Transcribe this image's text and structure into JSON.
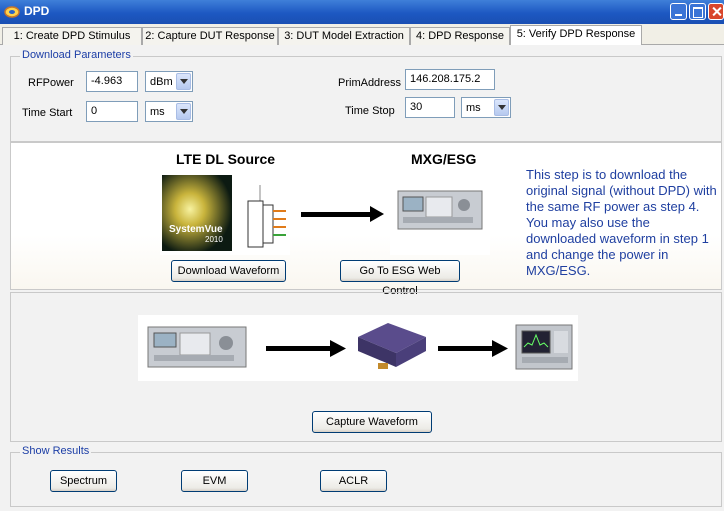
{
  "window": {
    "title": "DPD"
  },
  "tabs": [
    {
      "label": "1: Create DPD Stimulus"
    },
    {
      "label": "2: Capture DUT Response"
    },
    {
      "label": "3: DUT Model Extraction"
    },
    {
      "label": "4: DPD Response"
    },
    {
      "label": "5: Verify DPD Response"
    }
  ],
  "download_params": {
    "legend": "Download Parameters",
    "rfpower_label": "RFPower",
    "rfpower_value": "-4.963",
    "rfpower_unit": "dBm",
    "time_start_label": "Time Start",
    "time_start_value": "0",
    "time_start_unit": "ms",
    "prim_address_label": "PrimAddress",
    "prim_address_value": "146.208.175.2",
    "time_stop_label": "Time Stop",
    "time_stop_value": "30",
    "time_stop_unit": "ms"
  },
  "source_section": {
    "lte_heading": "LTE DL Source",
    "mxg_heading": "MXG/ESG",
    "systemvue_logo_text": "SystemVue",
    "systemvue_logo_year": "2010",
    "download_button": "Download Waveform",
    "esg_button": "Go To ESG Web Control",
    "description": "This step is to download the original signal (without DPD) with the same RF power as step 4. You may also use the downloaded waveform in step 1 and change the power in MXG/ESG."
  },
  "capture_section": {
    "capture_button": "Capture Waveform"
  },
  "results": {
    "legend": "Show Results",
    "spectrum_button": "Spectrum",
    "evm_button": "EVM",
    "aclr_button": "ACLR"
  },
  "colors": {
    "accent_text": "#1f3fa0",
    "titlebar": "#1d58c2"
  }
}
